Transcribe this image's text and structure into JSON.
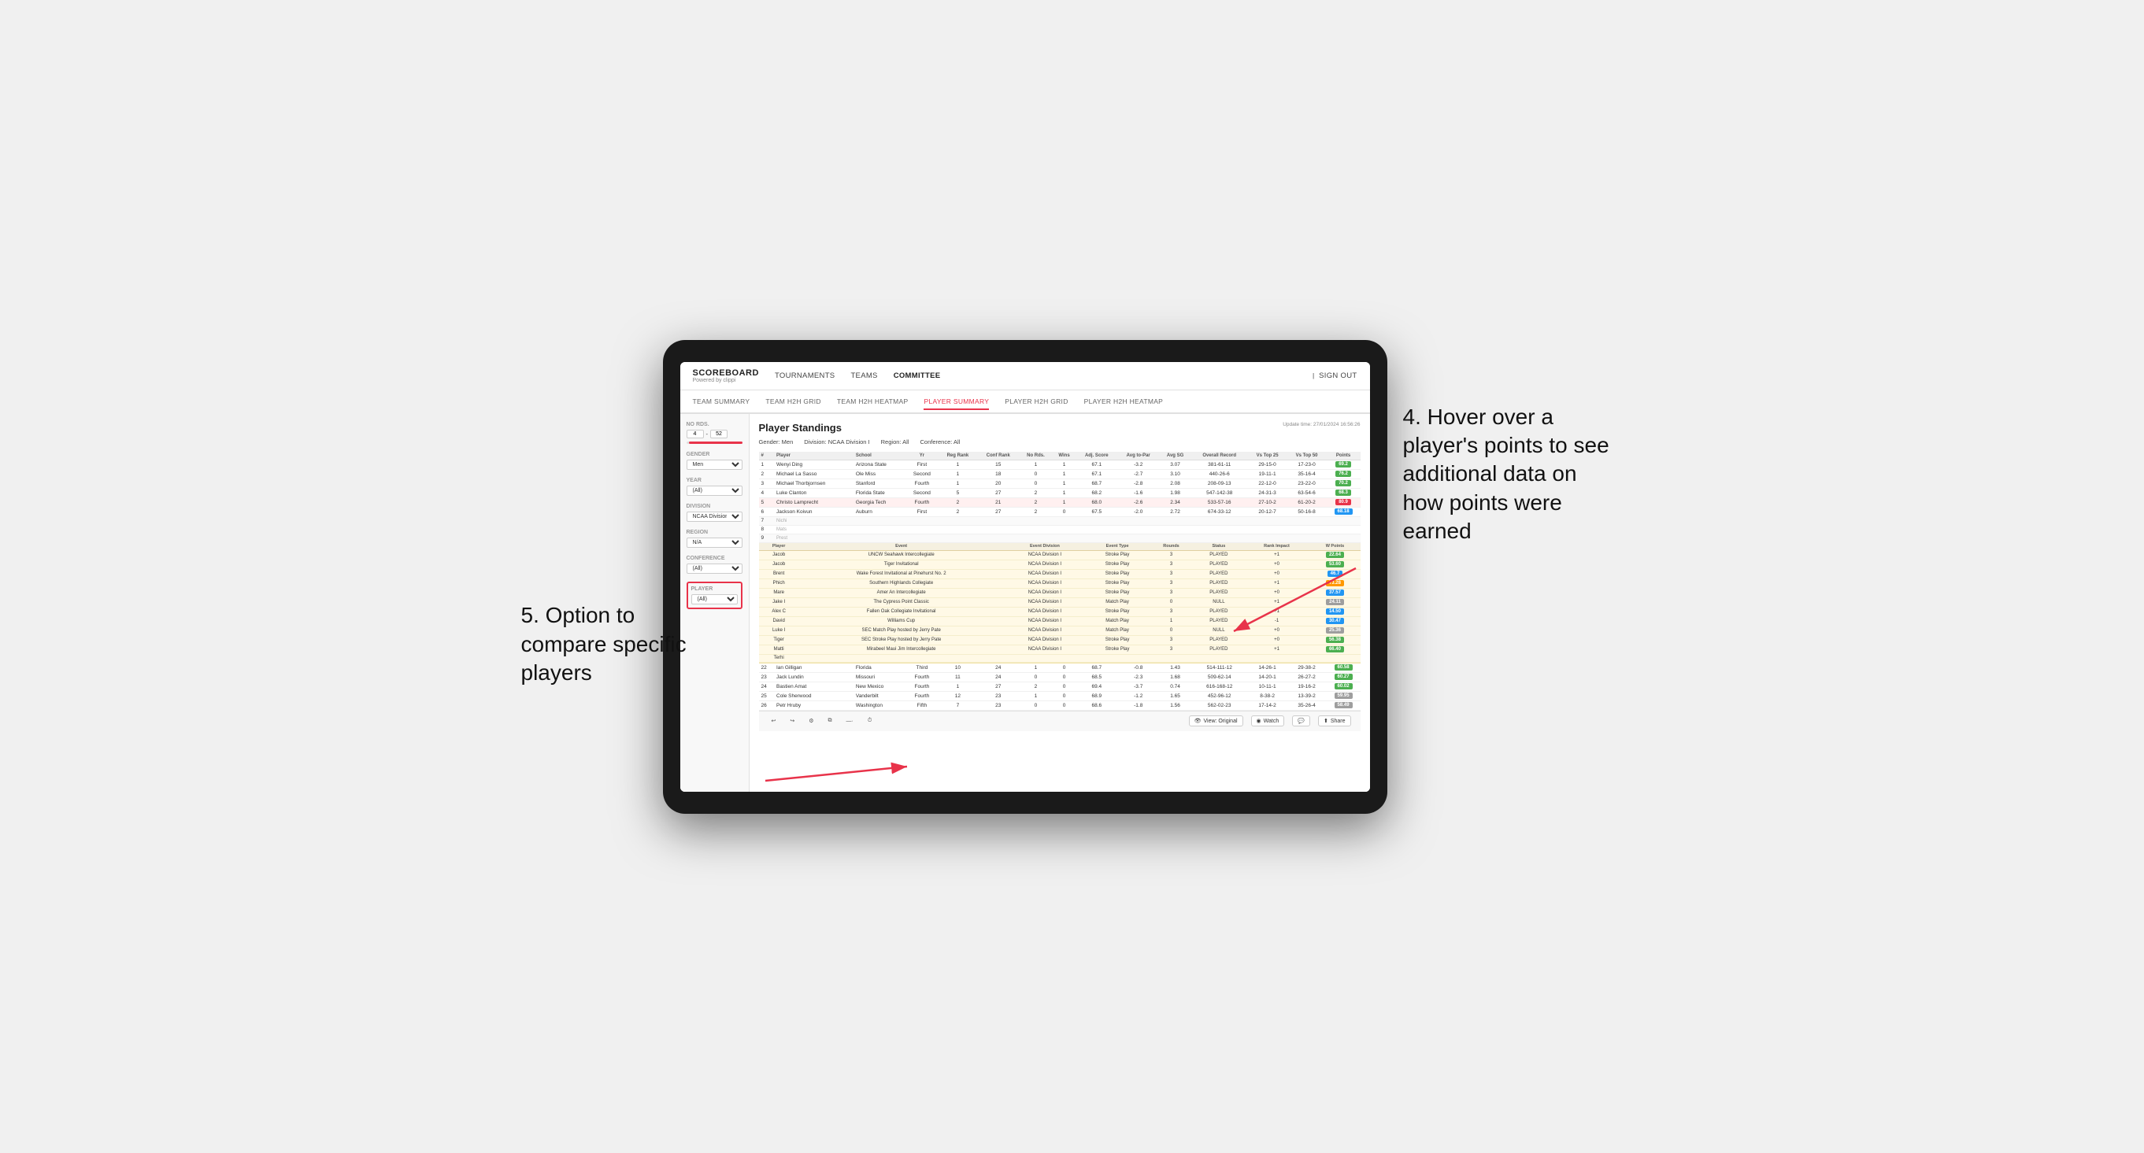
{
  "annotations": {
    "top_right": "4. Hover over a player's points to see additional data on how points were earned",
    "bottom_left": "5. Option to compare specific players"
  },
  "nav": {
    "logo": "SCOREBOARD",
    "logo_sub": "Powered by clippi",
    "links": [
      "TOURNAMENTS",
      "TEAMS",
      "COMMITTEE"
    ],
    "sign_out": "Sign out"
  },
  "sub_nav": {
    "links": [
      "TEAM SUMMARY",
      "TEAM H2H GRID",
      "TEAM H2H HEATMAP",
      "PLAYER SUMMARY",
      "PLAYER H2H GRID",
      "PLAYER H2H HEATMAP"
    ],
    "active": "PLAYER SUMMARY"
  },
  "sidebar": {
    "no_rds_label": "No Rds.",
    "no_rds_from": "4",
    "no_rds_to": "52",
    "gender_label": "Gender",
    "gender_value": "Men",
    "year_label": "Year",
    "year_value": "(All)",
    "division_label": "Division",
    "division_value": "NCAA Division I",
    "region_label": "Region",
    "region_value": "N/A",
    "conference_label": "Conference",
    "conference_value": "(All)",
    "player_label": "Player",
    "player_value": "(All)"
  },
  "content": {
    "title": "Player Standings",
    "update_time": "Update time: 27/01/2024 16:56:26",
    "filters": {
      "gender": "Gender: Men",
      "division": "Division: NCAA Division I",
      "region": "Region: All",
      "conference": "Conference: All"
    },
    "table_headers": [
      "#",
      "Player",
      "School",
      "Yr",
      "Reg Rank",
      "Conf Rank",
      "No Rds.",
      "Wins",
      "Adj. Score",
      "Avg to-Par",
      "Avg SG",
      "Overall Record",
      "Vs Top 25",
      "Vs Top 50",
      "Points"
    ],
    "main_rows": [
      {
        "rank": 1,
        "player": "Wenyi Ding",
        "school": "Arizona State",
        "yr": "First",
        "reg_rank": 1,
        "conf_rank": 15,
        "no_rds": 1,
        "wins": 1,
        "adj_score": 67.1,
        "to_par": -3.2,
        "sg": 3.07,
        "record": "381-61-11",
        "vs_top25": "29-15-0",
        "vs_top50": "17-23-0",
        "points": "69.2",
        "badge": "green"
      },
      {
        "rank": 2,
        "player": "Michael La Sasso",
        "school": "Ole Miss",
        "yr": "Second",
        "reg_rank": 1,
        "conf_rank": 18,
        "no_rds": 0,
        "wins": 1,
        "adj_score": 67.1,
        "to_par": -2.7,
        "sg": 3.1,
        "record": "440-26-6",
        "vs_top25": "19-11-1",
        "vs_top50": "35-16-4",
        "points": "76.2",
        "badge": "green"
      },
      {
        "rank": 3,
        "player": "Michael Thorbjornsen",
        "school": "Stanford",
        "yr": "Fourth",
        "reg_rank": 1,
        "conf_rank": 20,
        "no_rds": 0,
        "wins": 1,
        "adj_score": 68.7,
        "to_par": -2.8,
        "sg": 2.08,
        "record": "208-09-13",
        "vs_top25": "22-12-0",
        "vs_top50": "23-22-0",
        "points": "70.2",
        "badge": "green"
      },
      {
        "rank": 4,
        "player": "Luke Clanton",
        "school": "Florida State",
        "yr": "Second",
        "reg_rank": 5,
        "conf_rank": 27,
        "no_rds": 2,
        "wins": 1,
        "adj_score": 68.2,
        "to_par": -1.6,
        "sg": 1.98,
        "record": "547-142-38",
        "vs_top25": "24-31-3",
        "vs_top50": "63-54-6",
        "points": "68.3",
        "badge": "green"
      },
      {
        "rank": 5,
        "player": "Christo Lamprecht",
        "school": "Georgia Tech",
        "yr": "Fourth",
        "reg_rank": 2,
        "conf_rank": 21,
        "no_rds": 2,
        "wins": 1,
        "adj_score": 68.0,
        "to_par": -2.6,
        "sg": 2.34,
        "record": "533-57-16",
        "vs_top25": "27-10-2",
        "vs_top50": "61-20-2",
        "points": "80.9",
        "badge": "green",
        "highlighted": true
      },
      {
        "rank": 6,
        "player": "Jackson Koivun",
        "school": "Auburn",
        "yr": "First",
        "reg_rank": 2,
        "conf_rank": 27,
        "no_rds": 2,
        "wins": 0,
        "adj_score": 67.5,
        "to_par": -2.0,
        "sg": 2.72,
        "record": "674-33-12",
        "vs_top25": "20-12-7",
        "vs_top50": "50-16-8",
        "points": "68.18",
        "badge": "blue"
      },
      {
        "rank": 7,
        "player": "Nichi",
        "school": "",
        "yr": "",
        "reg_rank": null,
        "conf_rank": null,
        "no_rds": null,
        "wins": null,
        "adj_score": null,
        "to_par": null,
        "sg": null,
        "record": "",
        "vs_top25": "",
        "vs_top50": "",
        "points": "",
        "badge": ""
      },
      {
        "rank": 8,
        "player": "Mats",
        "school": "",
        "yr": "",
        "reg_rank": null,
        "conf_rank": null,
        "no_rds": null,
        "wins": null,
        "adj_score": null,
        "to_par": null,
        "sg": null,
        "record": "",
        "vs_top25": "",
        "vs_top50": "",
        "points": "",
        "badge": ""
      },
      {
        "rank": 9,
        "player": "Prest",
        "school": "",
        "yr": "",
        "reg_rank": null,
        "conf_rank": null,
        "no_rds": null,
        "wins": null,
        "adj_score": null,
        "to_par": null,
        "sg": null,
        "record": "",
        "vs_top25": "",
        "vs_top50": "",
        "points": "",
        "badge": ""
      }
    ],
    "tooltip_player": "Jackson Koivun",
    "tooltip_headers": [
      "Player",
      "Event",
      "Event Division",
      "Event Type",
      "Rounds",
      "Status",
      "Rank Impact",
      "W Points"
    ],
    "tooltip_rows": [
      {
        "player": "Jacob",
        "event": "UNCW Seahawk Intercollegiate",
        "division": "NCAA Division I",
        "type": "Stroke Play",
        "rounds": 3,
        "status": "PLAYED",
        "rank_impact": "+1",
        "points": "22.64",
        "badge": "green"
      },
      {
        "player": "Jacob",
        "event": "Tiger Invitational",
        "division": "NCAA Division I",
        "type": "Stroke Play",
        "rounds": 3,
        "status": "PLAYED",
        "rank_impact": "+0",
        "points": "53.60",
        "badge": "green"
      },
      {
        "player": "Brent",
        "event": "Wake Forest Invitational at Pinehurst No. 2",
        "division": "NCAA Division I",
        "type": "Stroke Play",
        "rounds": 3,
        "status": "PLAYED",
        "rank_impact": "+0",
        "points": "46.7",
        "badge": "blue"
      },
      {
        "player": "Phich",
        "event": "Southern Highlands Collegiate",
        "division": "NCAA Division I",
        "type": "Stroke Play",
        "rounds": 3,
        "status": "PLAYED",
        "rank_impact": "+1",
        "points": "73.28",
        "badge": "orange"
      },
      {
        "player": "Mare",
        "event": "Amer An Intercollegiate",
        "division": "NCAA Division I",
        "type": "Stroke Play",
        "rounds": 3,
        "status": "PLAYED",
        "rank_impact": "+0",
        "points": "37.57",
        "badge": "blue"
      },
      {
        "player": "Jake I",
        "event": "The Cypress Point Classic",
        "division": "NCAA Division I",
        "type": "Match Play",
        "rounds": 0,
        "status": "NULL",
        "rank_impact": "+1",
        "points": "24.11",
        "badge": "gray"
      },
      {
        "player": "Alex C",
        "event": "Fallen Oak Collegiate Invitational",
        "division": "NCAA Division I",
        "type": "Stroke Play",
        "rounds": 3,
        "status": "PLAYED",
        "rank_impact": "+1",
        "points": "14.50",
        "badge": "blue"
      },
      {
        "player": "David",
        "event": "Williams Cup",
        "division": "NCAA Division I",
        "type": "Match Play",
        "rounds": 1,
        "status": "PLAYED",
        "rank_impact": "-1",
        "points": "30.47",
        "badge": "blue"
      },
      {
        "player": "Luke I",
        "event": "SEC Match Play hosted by Jerry Pate",
        "division": "NCAA Division I",
        "type": "Match Play",
        "rounds": 0,
        "status": "NULL",
        "rank_impact": "+0",
        "points": "25.36",
        "badge": "gray"
      },
      {
        "player": "Tiger",
        "event": "SEC Stroke Play hosted by Jerry Pate",
        "division": "NCAA Division I",
        "type": "Stroke Play",
        "rounds": 3,
        "status": "PLAYED",
        "rank_impact": "+0",
        "points": "56.38",
        "badge": "green"
      },
      {
        "player": "Matti",
        "event": "Mirabeel Maui Jim Intercollegiate",
        "division": "NCAA Division I",
        "type": "Stroke Play",
        "rounds": 3,
        "status": "PLAYED",
        "rank_impact": "+1",
        "points": "66.40",
        "badge": "green"
      },
      {
        "player": "Terhi",
        "event": "",
        "division": "",
        "type": "",
        "rounds": null,
        "status": "",
        "rank_impact": "",
        "points": "",
        "badge": ""
      }
    ],
    "lower_rows": [
      {
        "rank": 22,
        "player": "Ian Gilligan",
        "school": "Florida",
        "yr": "Third",
        "reg_rank": 10,
        "conf_rank": 24,
        "no_rds": 1,
        "wins": 0,
        "adj_score": 68.7,
        "to_par": -0.8,
        "sg": 1.43,
        "record": "514-111-12",
        "vs_top25": "14-26-1",
        "vs_top50": "29-38-2",
        "points": "60.58",
        "badge": "green"
      },
      {
        "rank": 23,
        "player": "Jack Lundin",
        "school": "Missouri",
        "yr": "Fourth",
        "reg_rank": 11,
        "conf_rank": 24,
        "no_rds": 0,
        "wins": 0,
        "adj_score": 68.5,
        "to_par": -2.3,
        "sg": 1.68,
        "record": "509-62-14",
        "vs_top25": "14-20-1",
        "vs_top50": "26-27-2",
        "points": "60.27",
        "badge": "green"
      },
      {
        "rank": 24,
        "player": "Bastien Amat",
        "school": "New Mexico",
        "yr": "Fourth",
        "reg_rank": 1,
        "conf_rank": 27,
        "no_rds": 2,
        "wins": 0,
        "adj_score": 69.4,
        "to_par": -3.7,
        "sg": 0.74,
        "record": "616-168-12",
        "vs_top25": "10-11-1",
        "vs_top50": "19-16-2",
        "points": "60.02",
        "badge": "green"
      },
      {
        "rank": 25,
        "player": "Cole Sherwood",
        "school": "Vanderbilt",
        "yr": "Fourth",
        "reg_rank": 12,
        "conf_rank": 23,
        "no_rds": 1,
        "wins": 0,
        "adj_score": 68.9,
        "to_par": -1.2,
        "sg": 1.65,
        "record": "452-96-12",
        "vs_top25": "8-38-2",
        "vs_top50": "13-39-2",
        "points": "59.95",
        "badge": "gray"
      },
      {
        "rank": 26,
        "player": "Petr Hruby",
        "school": "Washington",
        "yr": "Fifth",
        "reg_rank": 7,
        "conf_rank": 23,
        "no_rds": 0,
        "wins": 0,
        "adj_score": 68.6,
        "to_par": -1.8,
        "sg": 1.56,
        "record": "562-02-23",
        "vs_top25": "17-14-2",
        "vs_top50": "35-26-4",
        "points": "58.49",
        "badge": "gray"
      }
    ]
  },
  "toolbar": {
    "view_original": "View: Original",
    "watch": "Watch",
    "share": "Share"
  }
}
